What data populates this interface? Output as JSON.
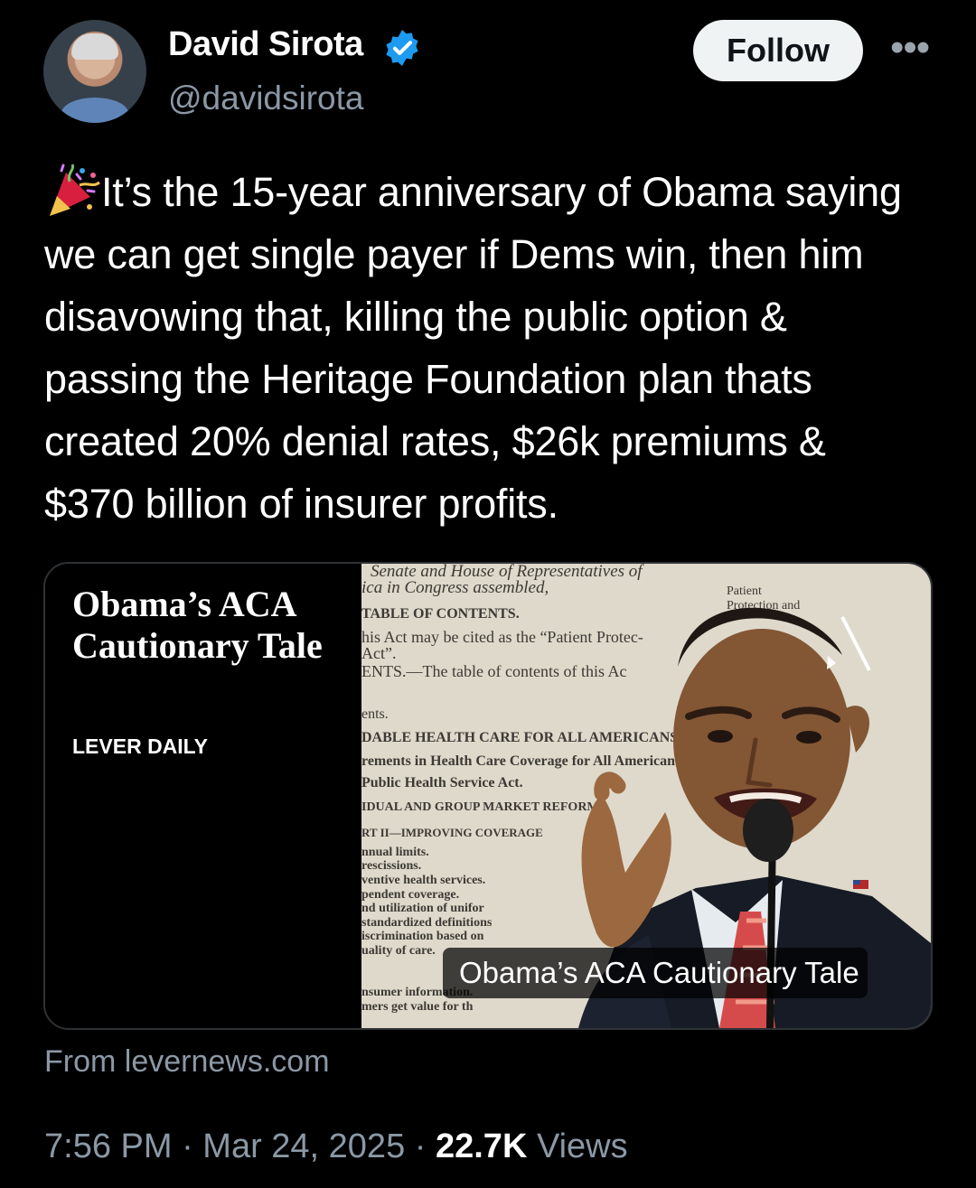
{
  "author": {
    "name": "David Sirota",
    "handle": "@davidsirota",
    "verified_color": "#1d9bf0",
    "verified_icon": "verified-badge-icon"
  },
  "follow_label": "Follow",
  "more_label": "•••",
  "tweet": {
    "emoji": "party-popper-icon",
    "text": "It’s the 15-year anniversary of Obama saying we can get single payer if Dems win, then him disavowing that, killing the public option & passing the Heritage Foundation plan thats created 20% denial rates, $26k premiums & $370 billion of insurer profits."
  },
  "card": {
    "title": "Obama’s ACA Cautionary Tale",
    "brand": "LEVER DAILY",
    "caption": "Obama’s ACA Cautionary Tale",
    "document_lines": [
      "Senate and House of Representatives of",
      "ica in Congress assembled,",
      "TABLE OF CONTENTS.",
      "his Act may be cited as the “Patient Protec-",
      "Act”.",
      "ENTS.—The table of contents of this Ac",
      "ents.",
      "DABLE HEALTH CARE FOR ALL AMERICANS",
      "rements in Health Care Coverage for All American",
      "Public Health Service Act.",
      "IDUAL AND GROUP MARKET REFORMS",
      "RT II—IMPROVING COVERAGE",
      "nnual limits.",
      "rescissions.",
      "ventive health services.",
      "pendent coverage.",
      "nd utilization of unifor",
      "standardized definitions",
      "iscrimination based on",
      "uality of care.",
      "nsumer information.",
      "mers get value for th",
      "Patient",
      "Protection and"
    ]
  },
  "source": "From levernews.com",
  "timestamp": "7:56 PM · Mar 24, 2025 · ",
  "views": {
    "count": "22.7K",
    "label": " Views"
  }
}
